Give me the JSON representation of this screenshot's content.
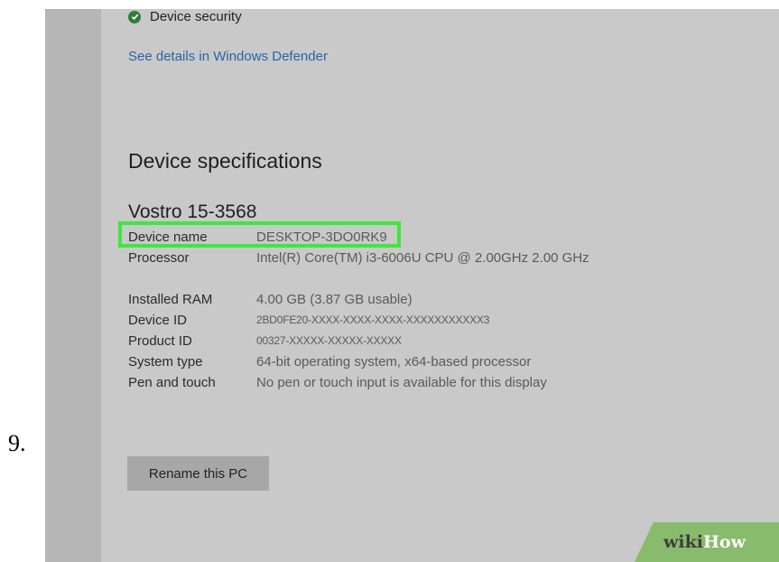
{
  "step_number": "9.",
  "security": {
    "label": "Device security",
    "link": "See details in Windows Defender"
  },
  "specs": {
    "title": "Device specifications",
    "model": "Vostro 15-3568",
    "rows": [
      {
        "label": "Device name",
        "value": "DESKTOP-3DO0RK9"
      },
      {
        "label": "Processor",
        "value": "Intel(R) Core(TM) i3-6006U CPU @ 2.00GHz   2.00 GHz"
      },
      {
        "label": "Installed RAM",
        "value": "4.00 GB (3.87 GB usable)"
      },
      {
        "label": "Device ID",
        "value": "2BD0FE20-XXXX-XXXX-XXXX-XXXXXXXXXXX3"
      },
      {
        "label": "Product ID",
        "value": "00327-XXXXX-XXXXX-XXXXX"
      },
      {
        "label": "System type",
        "value": "64-bit operating system, x64-based processor"
      },
      {
        "label": "Pen and touch",
        "value": "No pen or touch input is available for this display"
      }
    ]
  },
  "rename_button": "Rename this PC",
  "watermark": {
    "part1": "wiki",
    "part2": "How"
  },
  "colors": {
    "highlight": "#3fe63b",
    "link": "#2a64a6",
    "check": "#2f7d38",
    "badge": "#88bb6c"
  }
}
